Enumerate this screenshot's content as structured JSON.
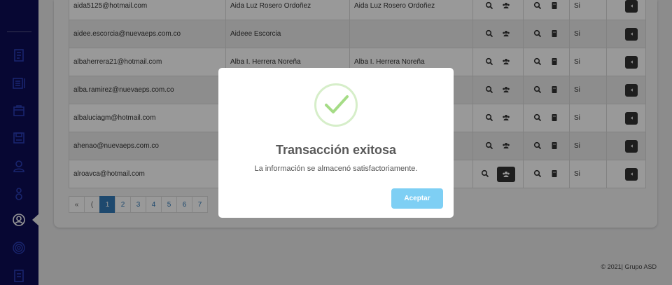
{
  "rows": [
    {
      "email": "aida5125@hotmail.com",
      "name": "Aida Luz Rosero Ordoñez",
      "name2": "Aida Luz Rosero Ordoñez",
      "active": "Si"
    },
    {
      "email": "aidee.escorcia@nuevaeps.com.co",
      "name": "Aideee Escorcia",
      "name2": "",
      "active": "Si"
    },
    {
      "email": "albaherrera21@hotmail.com",
      "name": "Alba I. Herrera Noreña",
      "name2": "Alba I. Herrera Noreña",
      "active": "Si"
    },
    {
      "email": "alba.ramirez@nuevaeps.com.co",
      "name": "",
      "name2": "",
      "active": "Si"
    },
    {
      "email": "albaluciagm@hotmail.com",
      "name": "",
      "name2": ")",
      "active": "Si"
    },
    {
      "email": "ahenao@nuevaeps.com.co",
      "name": "",
      "name2": "",
      "active": "Si"
    },
    {
      "email": "alroavca@hotmail.com",
      "name": "",
      "name2": "",
      "active": "Si"
    }
  ],
  "pagination": {
    "first": "«",
    "prev": "(",
    "pages": [
      "1",
      "2",
      "3",
      "4",
      "5",
      "6",
      "7"
    ],
    "active_page": "1"
  },
  "footer": {
    "text": "© 2021| Grupo ASD"
  },
  "modal": {
    "title": "Transacción exitosa",
    "message": "La información se almacenó satisfactoriamente.",
    "confirm_label": "Aceptar"
  },
  "sidebar": {
    "icons": [
      "document-icon",
      "list-icon",
      "box-icon",
      "save-icon",
      "user-icon",
      "person-icon",
      "user-circle-icon",
      "fingerprint-icon",
      "report-icon"
    ],
    "active": "user-circle-icon"
  },
  "colors": {
    "sidebar": "#0c0c55",
    "accent": "#337ab7",
    "confirm": "#7ecff4",
    "success": "#a5dc86"
  }
}
